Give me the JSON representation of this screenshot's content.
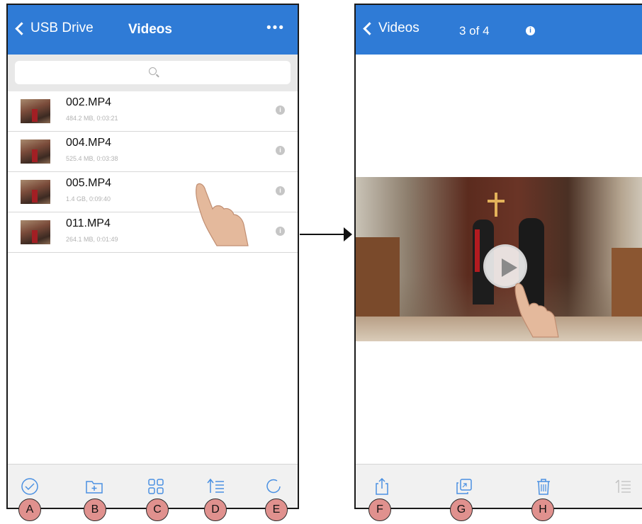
{
  "left_screen": {
    "nav": {
      "back_label": "USB Drive",
      "title": "Videos",
      "more_label": "•••"
    },
    "search": {
      "placeholder": ""
    },
    "files": [
      {
        "name": "002.MP4",
        "meta": "484.2 MB, 0:03:21"
      },
      {
        "name": "004.MP4",
        "meta": "525.4 MB, 0:03:38"
      },
      {
        "name": "005.MP4",
        "meta": "1.4 GB, 0:09:40"
      },
      {
        "name": "011.MP4",
        "meta": "264.1 MB, 0:01:49"
      }
    ],
    "toolbar_icons": [
      "checkmark-circle-icon",
      "new-folder-icon",
      "grid-view-icon",
      "sort-list-icon",
      "refresh-icon"
    ]
  },
  "right_screen": {
    "nav": {
      "back_label": "Videos",
      "title": "3 of 4",
      "info_label": "i"
    },
    "toolbar_icons": [
      "share-icon",
      "copy-icon",
      "trash-icon",
      "list-icon"
    ]
  },
  "markers": [
    "A",
    "B",
    "C",
    "D",
    "E",
    "F",
    "G",
    "H"
  ],
  "colors": {
    "nav_blue": "#2f7bd6",
    "toolbar_blue": "#4a90e2",
    "marker_fill": "#e0918e"
  }
}
